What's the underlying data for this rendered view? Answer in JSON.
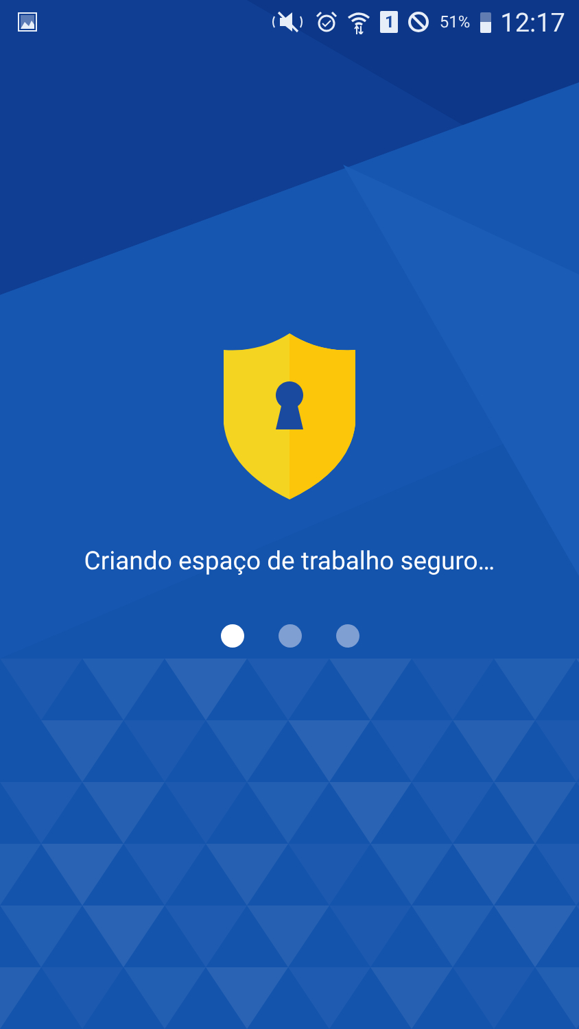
{
  "status_bar": {
    "sim_slot": "1",
    "battery_percent": "51%",
    "time": "12:17"
  },
  "message": "Criando espaço de trabalho seguro…",
  "pager_dots": [
    {
      "selected": true
    },
    {
      "selected": false
    },
    {
      "selected": false
    }
  ]
}
